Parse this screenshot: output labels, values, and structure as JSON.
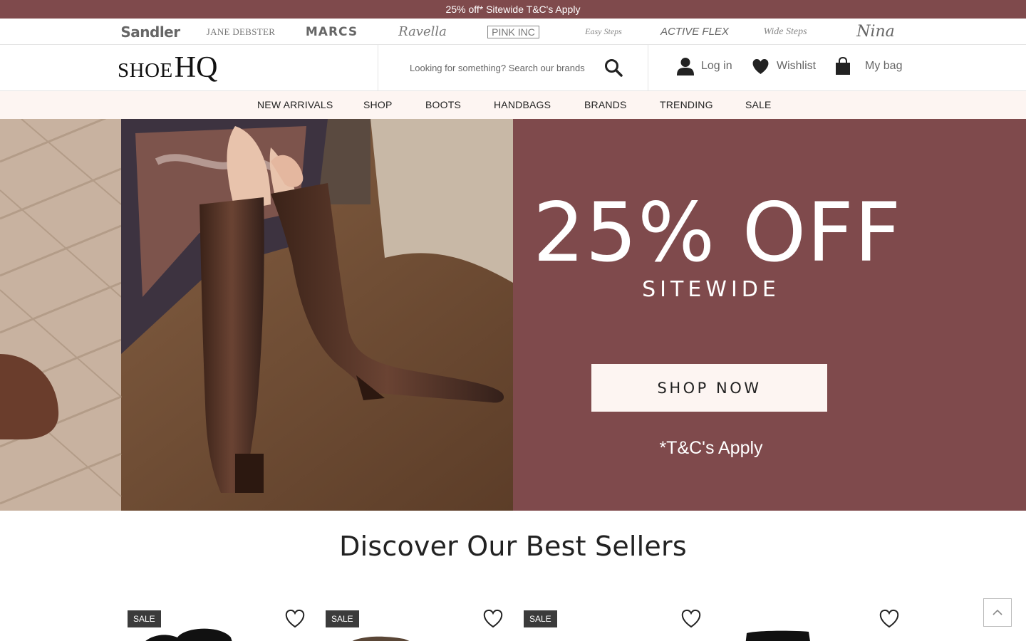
{
  "promo": {
    "text": "25% off* Sitewide T&C's Apply"
  },
  "brands": {
    "sandler": "Sandler",
    "jane_debster": "JANE DEBSTER",
    "marcs": "MARCS",
    "ravella": "Ravella",
    "pink_inc": "PINK INC",
    "easy_steps": "Easy Steps",
    "active_flex": "ACTIVE FLEX",
    "wide_steps": "Wide Steps",
    "nina": "Nina"
  },
  "header": {
    "logo_shoe": "SHOE",
    "logo_hq": "HQ",
    "search_placeholder": "Looking for something? Search our brands",
    "login": "Log in",
    "wishlist": "Wishlist",
    "bag": "My bag"
  },
  "nav": [
    "NEW ARRIVALS",
    "SHOP",
    "BOOTS",
    "HANDBAGS",
    "BRANDS",
    "TRENDING",
    "SALE"
  ],
  "hero": {
    "headline": "25% OFF",
    "asterisk": "*",
    "subheadline": "SITEWIDE",
    "cta": "SHOP NOW",
    "terms": "*T&C's Apply"
  },
  "best_sellers": {
    "title": "Discover Our Best Sellers",
    "products": [
      {
        "badge": "SALE"
      },
      {
        "badge": "SALE"
      },
      {
        "badge": "SALE"
      },
      {
        "badge": ""
      }
    ]
  },
  "colors": {
    "brand_maroon": "#7f4a4c",
    "nav_background": "#fdf5f2",
    "cta_background": "#fdf5f2",
    "badge_background": "#3b3b3b"
  },
  "icons": [
    "search-icon",
    "user-icon",
    "heart-icon",
    "bag-icon",
    "chevron-up-icon"
  ]
}
